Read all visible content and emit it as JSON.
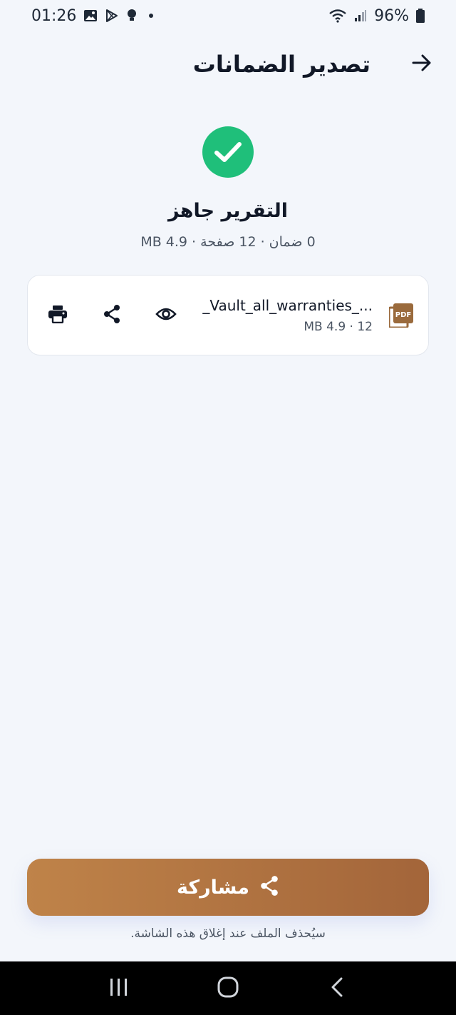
{
  "status_bar": {
    "time": "01:26",
    "battery": "96%",
    "left_icons": [
      "image-icon",
      "play-store-icon",
      "bulb-icon",
      "dot-icon"
    ],
    "right_icons": [
      "wifi-icon",
      "signal-icon",
      "battery-icon"
    ]
  },
  "header": {
    "title": "تصدير الضمانات",
    "back_icon": "arrow-right-icon"
  },
  "report": {
    "status_icon": "check-circle-icon",
    "title": "التقرير جاهز",
    "meta": "0 ضمان · 12 صفحة · 4.9 MB"
  },
  "file": {
    "icon": "pdf-file-icon",
    "name": "_Vault_all_warranties_...",
    "size": "12 · 4.9 MB",
    "actions": [
      {
        "name": "preview",
        "icon": "eye-icon"
      },
      {
        "name": "share",
        "icon": "share-icon"
      },
      {
        "name": "print",
        "icon": "printer-icon"
      }
    ]
  },
  "share_button": {
    "label": "مشاركة",
    "icon": "share-icon"
  },
  "footer_note": "سيُحذف الملف عند إغلاق هذه الشاشة.",
  "nav_bar": {
    "buttons": [
      "recent-apps-icon",
      "home-icon",
      "back-icon"
    ]
  },
  "colors": {
    "background": "#f3f6fb",
    "success": "#1fbf7a",
    "accent_start": "#bf8349",
    "accent_end": "#a3653a",
    "pdf_icon": "#9a6a3c"
  }
}
